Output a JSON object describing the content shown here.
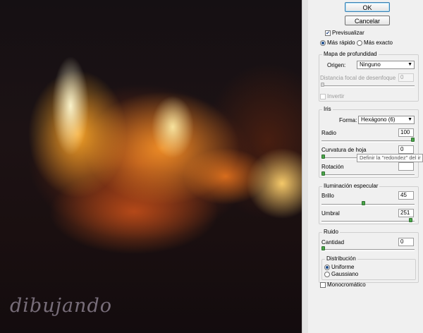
{
  "watermark": "dibujando",
  "buttons": {
    "ok": "OK",
    "cancel": "Cancelar"
  },
  "preview": {
    "label": "Previsualizar",
    "checked": true,
    "fast": "Más rápido",
    "exact": "Más exacto",
    "selected": "fast"
  },
  "depth_map": {
    "title": "Mapa de profundidad",
    "origin_label": "Origen:",
    "origin_value": "Ninguno",
    "focal_label": "Distancia focal de desenfoque",
    "focal_value": "0",
    "invert_label": "Invertir"
  },
  "iris": {
    "title": "Iris",
    "shape_label": "Forma:",
    "shape_value": "Hexágono (6)",
    "radius_label": "Radio",
    "radius_value": "100",
    "radius_level": 1.0,
    "curvature_label": "Curvatura de hoja",
    "curvature_value": "0",
    "curvature_level": 0.0,
    "rotation_label": "Rotación",
    "rotation_value": "",
    "rotation_level": 0.0
  },
  "tooltip": "Definir la \"redondez\" del ir",
  "specular": {
    "title": "Iluminación especular",
    "brightness_label": "Brillo",
    "brightness_value": "45",
    "brightness_level": 0.45,
    "threshold_label": "Umbral",
    "threshold_value": "251",
    "threshold_level": 0.98
  },
  "noise": {
    "title": "Ruido",
    "amount_label": "Cantidad",
    "amount_value": "0",
    "amount_level": 0.0,
    "distribution_title": "Distribución",
    "uniform": "Uniforme",
    "gaussian": "Gaussiano",
    "selected": "uniform",
    "mono_label": "Monocromático"
  },
  "colors": {
    "slider_thumb": "#4aa64a",
    "default_button_border": "#3c7fb1"
  }
}
